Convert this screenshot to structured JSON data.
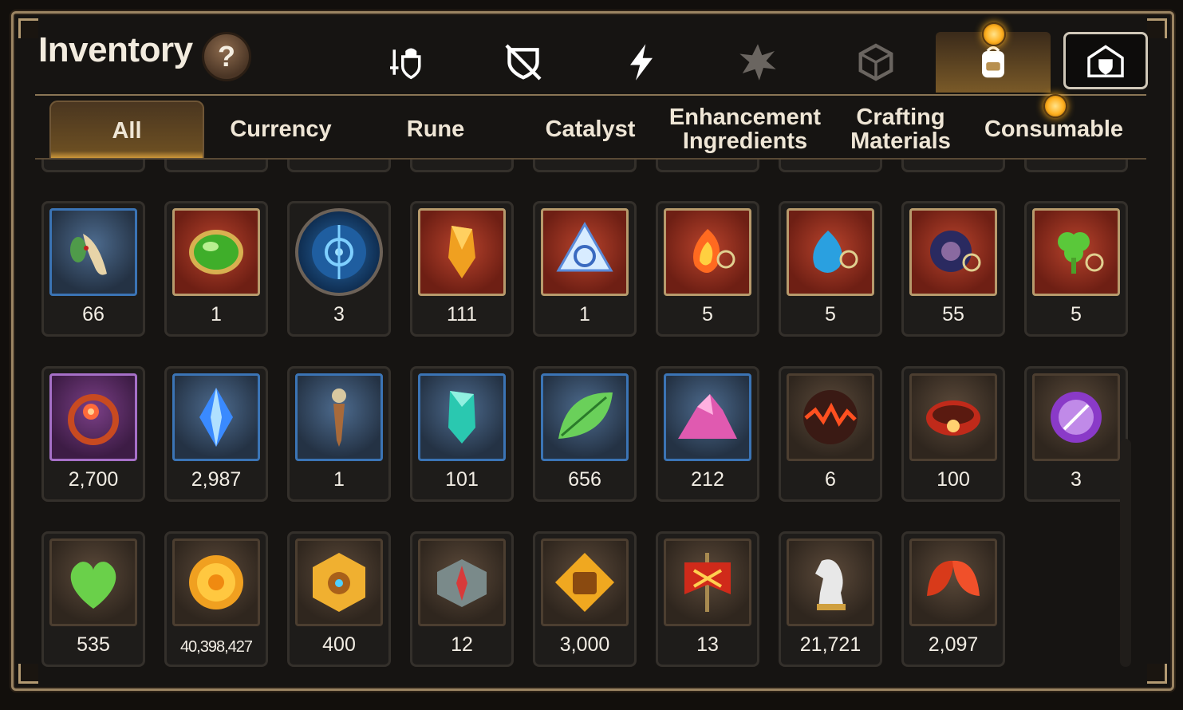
{
  "header": {
    "title": "Inventory",
    "help_label": "?"
  },
  "category_icons": [
    {
      "name": "equipment-icon"
    },
    {
      "name": "broken-shield-icon"
    },
    {
      "name": "lightning-icon"
    },
    {
      "name": "shattered-star-icon"
    },
    {
      "name": "cube-icon"
    },
    {
      "name": "backpack-icon",
      "active": true,
      "notification": true
    },
    {
      "name": "storage-chest-icon"
    }
  ],
  "tabs": [
    {
      "label": "All",
      "active": true
    },
    {
      "label": "Currency"
    },
    {
      "label": "Rune"
    },
    {
      "label": "Catalyst"
    },
    {
      "label": "Enhancement Ingredients"
    },
    {
      "label": "Crafting Materials"
    },
    {
      "label": "Consumable",
      "notification": true
    }
  ],
  "rows": [
    [
      {
        "icon": "root-herb-icon",
        "frame": "blue",
        "count": "66"
      },
      {
        "icon": "green-gem-icon",
        "frame": "red",
        "count": "1"
      },
      {
        "icon": "blue-rune-disc-icon",
        "frame": "round",
        "count": "3"
      },
      {
        "icon": "amber-crystal-icon",
        "frame": "red",
        "count": "111"
      },
      {
        "icon": "triquetra-crystal-icon",
        "frame": "red",
        "count": "1"
      },
      {
        "icon": "fire-pendant-icon",
        "frame": "red",
        "count": "5"
      },
      {
        "icon": "water-pendant-icon",
        "frame": "red",
        "count": "5"
      },
      {
        "icon": "dark-ring-pendant-icon",
        "frame": "red",
        "count": "55"
      },
      {
        "icon": "clover-pendant-icon",
        "frame": "red",
        "count": "5"
      }
    ],
    [
      {
        "icon": "flower-ring-icon",
        "frame": "purple",
        "count": "2,700"
      },
      {
        "icon": "blue-crystal-icon",
        "frame": "blue",
        "count": "2,987"
      },
      {
        "icon": "pendulum-icon",
        "frame": "blue",
        "count": "1"
      },
      {
        "icon": "teal-crystal-icon",
        "frame": "blue",
        "count": "101"
      },
      {
        "icon": "leaf-icon",
        "frame": "blue",
        "count": "656"
      },
      {
        "icon": "pink-ore-icon",
        "frame": "blue",
        "count": "212"
      },
      {
        "icon": "lava-orb-icon",
        "frame": "brown",
        "count": "6"
      },
      {
        "icon": "red-bracelet-icon",
        "frame": "brown",
        "count": "100"
      },
      {
        "icon": "purple-badge-icon",
        "frame": "brown",
        "count": "3"
      }
    ],
    [
      {
        "icon": "green-heart-icon",
        "frame": "brown",
        "count": "535"
      },
      {
        "icon": "gold-coin-icon",
        "frame": "brown",
        "count": "40,398,427",
        "small": true
      },
      {
        "icon": "gold-emblem-icon",
        "frame": "brown",
        "count": "400"
      },
      {
        "icon": "stone-compass-icon",
        "frame": "brown",
        "count": "12"
      },
      {
        "icon": "fist-medal-icon",
        "frame": "brown",
        "count": "3,000"
      },
      {
        "icon": "war-banner-icon",
        "frame": "brown",
        "count": "13"
      },
      {
        "icon": "silver-knight-icon",
        "frame": "brown",
        "count": "21,721"
      },
      {
        "icon": "red-leaves-icon",
        "frame": "brown",
        "count": "2,097"
      }
    ]
  ],
  "colors": {
    "accent": "#f0b040",
    "frame_gold": "#b79a6c",
    "count_text": "#f2ede4"
  }
}
